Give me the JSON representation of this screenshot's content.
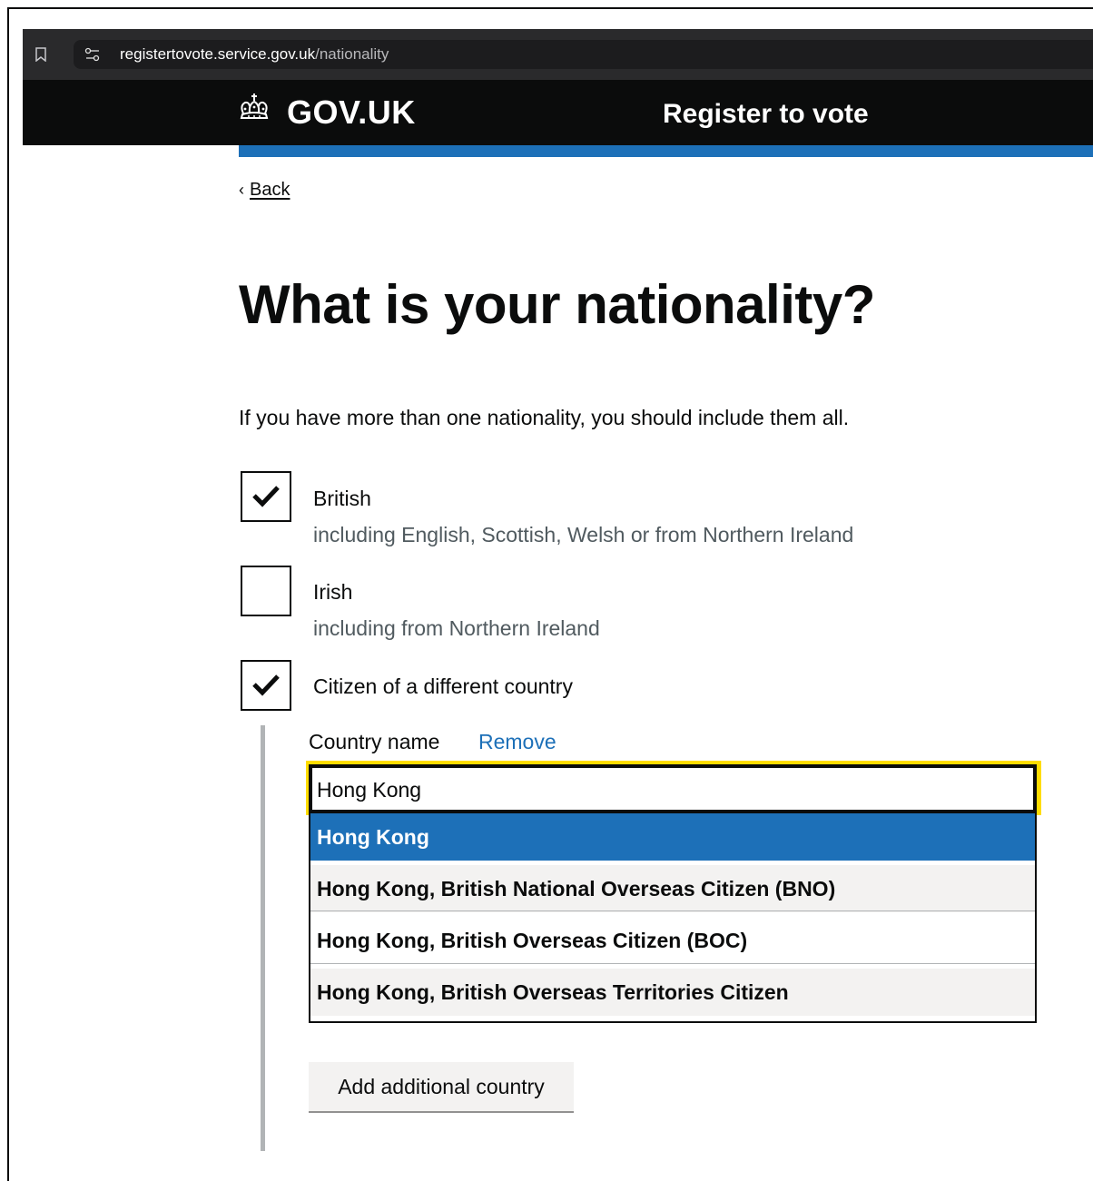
{
  "browser": {
    "url_host": "registertovote.service.gov.uk",
    "url_path": "/nationality",
    "bookmark_icon": "bookmark-icon",
    "site_settings_icon": "site-settings-icon"
  },
  "header": {
    "logo_text": "GOV.UK",
    "logo_icon": "crown-icon",
    "service_name": "Register to vote"
  },
  "back_link": {
    "label": "Back"
  },
  "page": {
    "title": "What is your nationality?",
    "hint": "If you have more than one nationality, you should include them all."
  },
  "nationality_options": [
    {
      "label": "British",
      "hint": "including English, Scottish, Welsh or from Northern Ireland",
      "checked": true
    },
    {
      "label": "Irish",
      "hint": "including from Northern Ireland",
      "checked": false
    },
    {
      "label": "Citizen of a different country",
      "checked": true
    }
  ],
  "other_country": {
    "field_label": "Country name",
    "remove_label": "Remove",
    "input_value": "Hong Kong",
    "suggestions": [
      "Hong Kong",
      "Hong Kong, British National Overseas Citizen (BNO)",
      "Hong Kong, British Overseas Citizen (BOC)",
      "Hong Kong, British Overseas Territories Citizen"
    ],
    "active_suggestion_index": 0,
    "add_button_label": "Add additional country"
  },
  "colors": {
    "brand_blue": "#1d70b8",
    "header_black": "#0b0c0c",
    "focus_yellow": "#ffdd00",
    "hint_grey": "#505a5f"
  }
}
